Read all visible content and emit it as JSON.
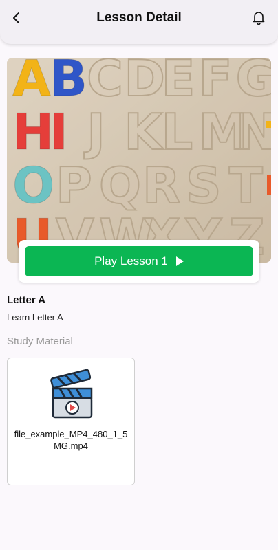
{
  "header": {
    "title": "Lesson Detail",
    "back_icon": "chevron-left-icon",
    "notification_icon": "bell-icon"
  },
  "hero": {
    "image_description_icon": "alphabet-puzzle-image",
    "letters": [
      "A",
      "B",
      "C",
      "D",
      "E",
      "F",
      "G",
      "H",
      "I",
      "J",
      "K",
      "L",
      "M",
      "N",
      "O",
      "P",
      "Q",
      "R",
      "S",
      "T",
      "U",
      "V",
      "W",
      "X",
      "Y",
      "Z"
    ]
  },
  "play": {
    "label": "Play Lesson 1",
    "icon": "play-icon",
    "color": "#0bb653"
  },
  "lesson": {
    "title": "Letter A",
    "description": "Learn Letter A"
  },
  "study_material": {
    "label": "Study Material",
    "files": [
      {
        "name": "file_example_MP4_480_1_5MG.mp4",
        "icon": "video-clapperboard-icon"
      }
    ]
  }
}
